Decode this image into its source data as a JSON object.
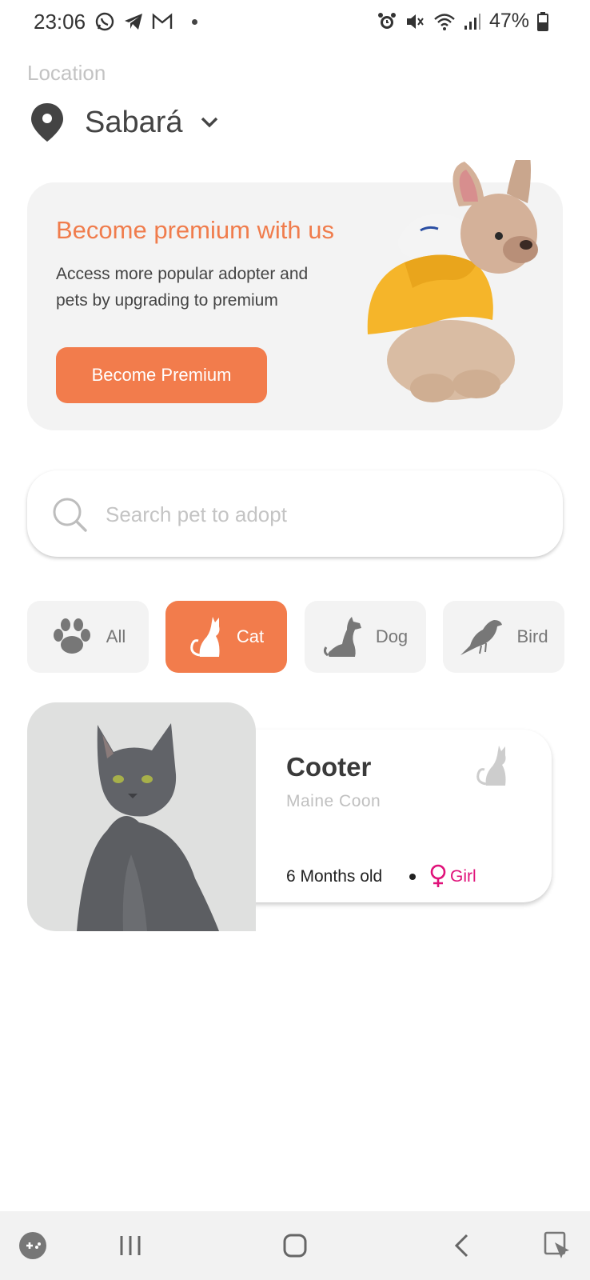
{
  "status_bar": {
    "time": "23:06",
    "battery": "47%",
    "left_icons": [
      "whatsapp-icon",
      "telegram-icon",
      "gmail-icon",
      "dot"
    ],
    "right_icons": [
      "alarm-icon",
      "mute-icon",
      "wifi-icon",
      "signal-icon",
      "battery-icon"
    ]
  },
  "location": {
    "label": "Location",
    "city": "Sabará"
  },
  "premium": {
    "title": "Become premium with us",
    "description": "Access more popular adopter and pets by upgrading to premium",
    "button_label": "Become Premium"
  },
  "search": {
    "placeholder": "Search pet to adopt",
    "value": ""
  },
  "categories": [
    {
      "label": "All",
      "icon": "paw-icon",
      "active": false
    },
    {
      "label": "Cat",
      "icon": "cat-icon",
      "active": true
    },
    {
      "label": "Dog",
      "icon": "dog-icon",
      "active": false
    },
    {
      "label": "Bird",
      "icon": "bird-icon",
      "active": false
    }
  ],
  "pets": [
    {
      "name": "Cooter",
      "breed": "Maine Coon",
      "age": "6 Months old",
      "gender": "Girl",
      "type_icon": "cat-icon"
    }
  ],
  "nav_bar": {
    "items": [
      "game-launcher-icon",
      "recent-apps-icon",
      "home-icon",
      "back-icon",
      "assistant-icon"
    ]
  },
  "colors": {
    "accent": "#f27c4c",
    "card_bg": "#f3f3f3",
    "gender_girl": "#e0127a"
  }
}
